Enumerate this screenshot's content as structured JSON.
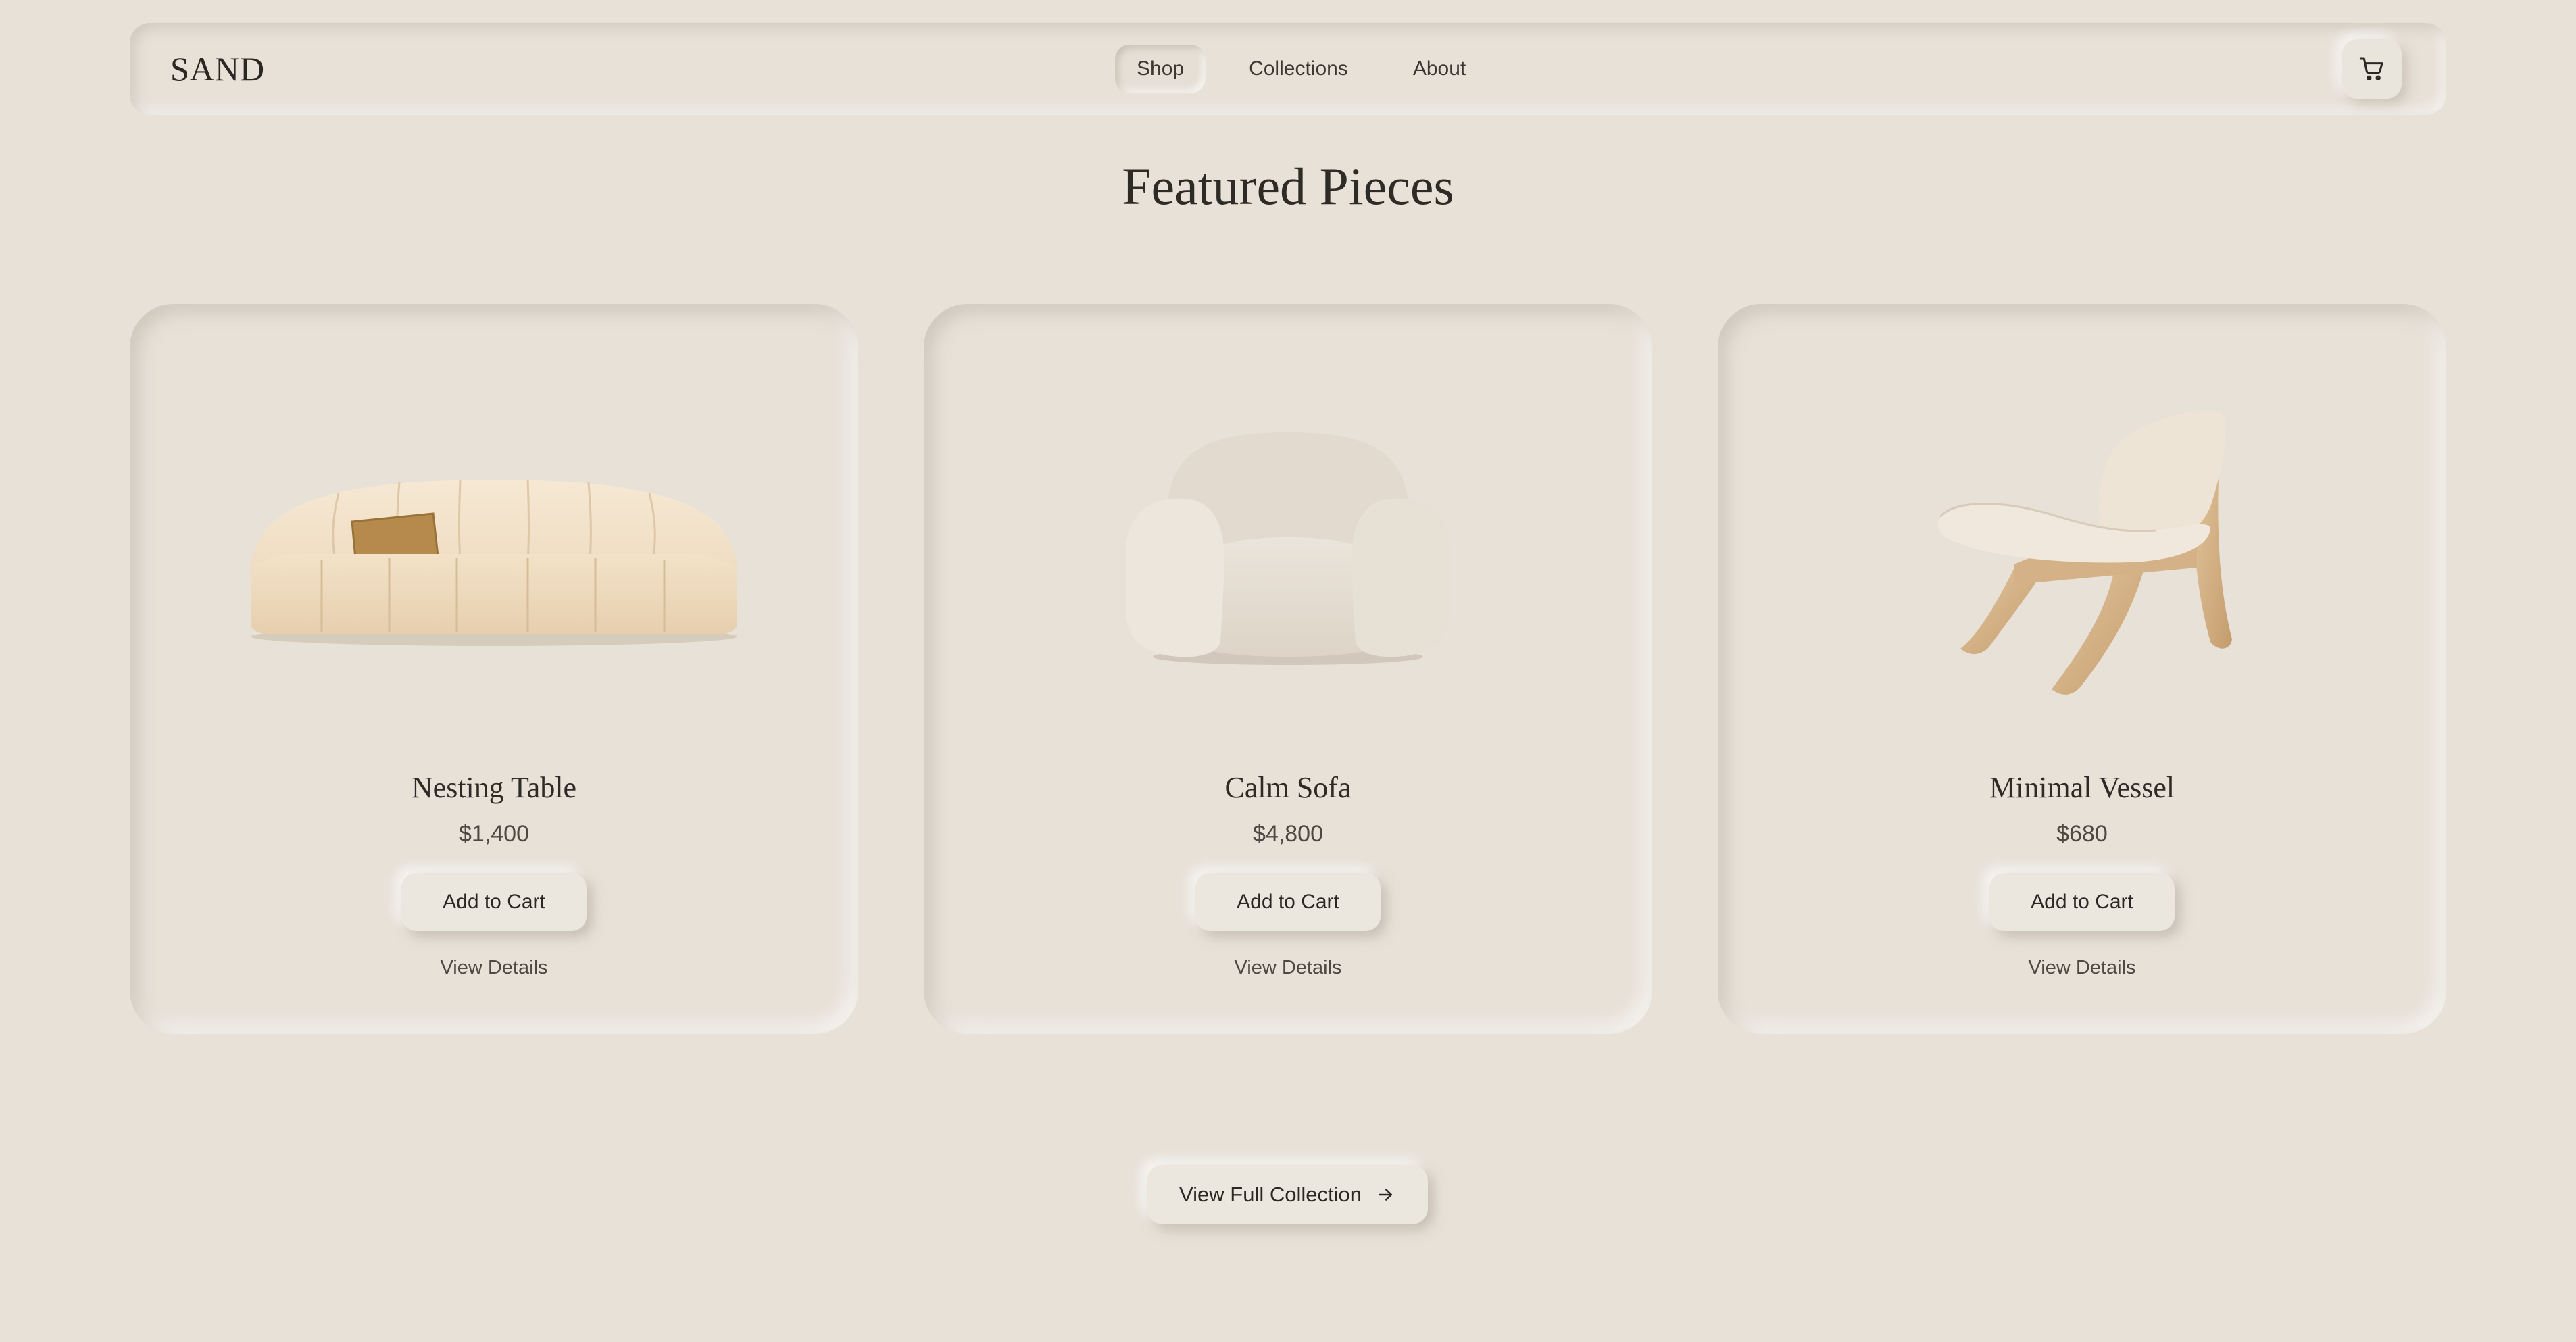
{
  "brand": "SAND",
  "nav": {
    "items": [
      {
        "label": "Shop",
        "active": true
      },
      {
        "label": "Collections",
        "active": false
      },
      {
        "label": "About",
        "active": false
      }
    ],
    "cart_icon": "cart-icon"
  },
  "page_title": "Featured Pieces",
  "products": [
    {
      "name": "Nesting Table",
      "price": "$1,400",
      "add_label": "Add to Cart",
      "details_label": "View Details",
      "image_icon": "curved-sofa-image"
    },
    {
      "name": "Calm Sofa",
      "price": "$4,800",
      "add_label": "Add to Cart",
      "details_label": "View Details",
      "image_icon": "armchair-image"
    },
    {
      "name": "Minimal Vessel",
      "price": "$680",
      "add_label": "Add to Cart",
      "details_label": "View Details",
      "image_icon": "lounge-chair-image"
    }
  ],
  "cta": {
    "label": "View Full Collection",
    "icon": "arrow-right-icon"
  },
  "colors": {
    "background": "#e7e1d8",
    "text": "#2e2b27",
    "accent_pillow": "#b58a4c"
  }
}
